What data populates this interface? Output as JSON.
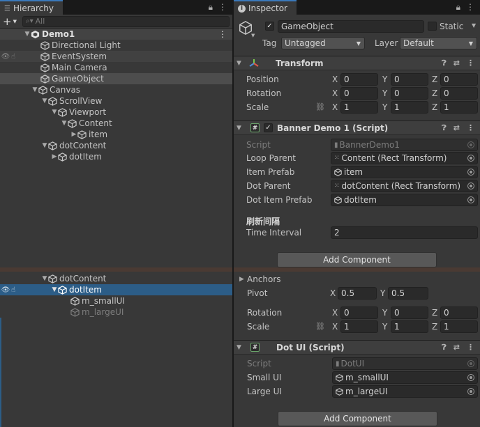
{
  "hierarchy": {
    "tab_label": "Hierarchy",
    "add_label": "+",
    "search_placeholder": "All",
    "scene": "Demo1",
    "items": [
      {
        "label": "Directional Light"
      },
      {
        "label": "EventSystem"
      },
      {
        "label": "Main Camera"
      },
      {
        "label": "GameObject"
      },
      {
        "label": "Canvas"
      },
      {
        "label": "ScrollView"
      },
      {
        "label": "Viewport"
      },
      {
        "label": "Content"
      },
      {
        "label": "item"
      },
      {
        "label": "dotContent"
      },
      {
        "label": "dotItem"
      }
    ],
    "lower_items": [
      {
        "label": "dotContent"
      },
      {
        "label": "dotItem"
      },
      {
        "label": "m_smallUI"
      },
      {
        "label": "m_largeUI"
      }
    ]
  },
  "inspector": {
    "tab_label": "Inspector",
    "object_name": "GameObject",
    "static_label": "Static",
    "tag_label": "Tag",
    "tag_value": "Untagged",
    "layer_label": "Layer",
    "layer_value": "Default",
    "transform": {
      "title": "Transform",
      "position_label": "Position",
      "rotation_label": "Rotation",
      "scale_label": "Scale",
      "position": {
        "x": "0",
        "y": "0",
        "z": "0"
      },
      "rotation": {
        "x": "0",
        "y": "0",
        "z": "0"
      },
      "scale": {
        "x": "1",
        "y": "1",
        "z": "1"
      }
    },
    "axis": {
      "x": "X",
      "y": "Y",
      "z": "Z"
    },
    "banner": {
      "title": "Banner Demo 1 (Script)",
      "script_label": "Script",
      "script_value": "BannerDemo1",
      "loop_parent_label": "Loop Parent",
      "loop_parent_value": "Content (Rect Transform)",
      "item_prefab_label": "Item Prefab",
      "item_prefab_value": "item",
      "dot_parent_label": "Dot Parent",
      "dot_parent_value": "dotContent (Rect Transform)",
      "dot_item_prefab_label": "Dot Item Prefab",
      "dot_item_prefab_value": "dotItem",
      "section_header": "刷新间隔",
      "time_interval_label": "Time Interval",
      "time_interval_value": "2"
    },
    "add_component_label": "Add Component"
  },
  "inspector2": {
    "anchors_label": "Anchors",
    "pivot_label": "Pivot",
    "pivot": {
      "x": "0.5",
      "y": "0.5"
    },
    "rotation_label": "Rotation",
    "rotation": {
      "x": "0",
      "y": "0",
      "z": "0"
    },
    "scale_label": "Scale",
    "scale": {
      "x": "1",
      "y": "1",
      "z": "1"
    },
    "dotui": {
      "title": "Dot UI (Script)",
      "script_label": "Script",
      "script_value": "DotUI",
      "small_ui_label": "Small UI",
      "small_ui_value": "m_smallUI",
      "large_ui_label": "Large UI",
      "large_ui_value": "m_largeUI"
    },
    "add_component_label": "Add Component"
  }
}
